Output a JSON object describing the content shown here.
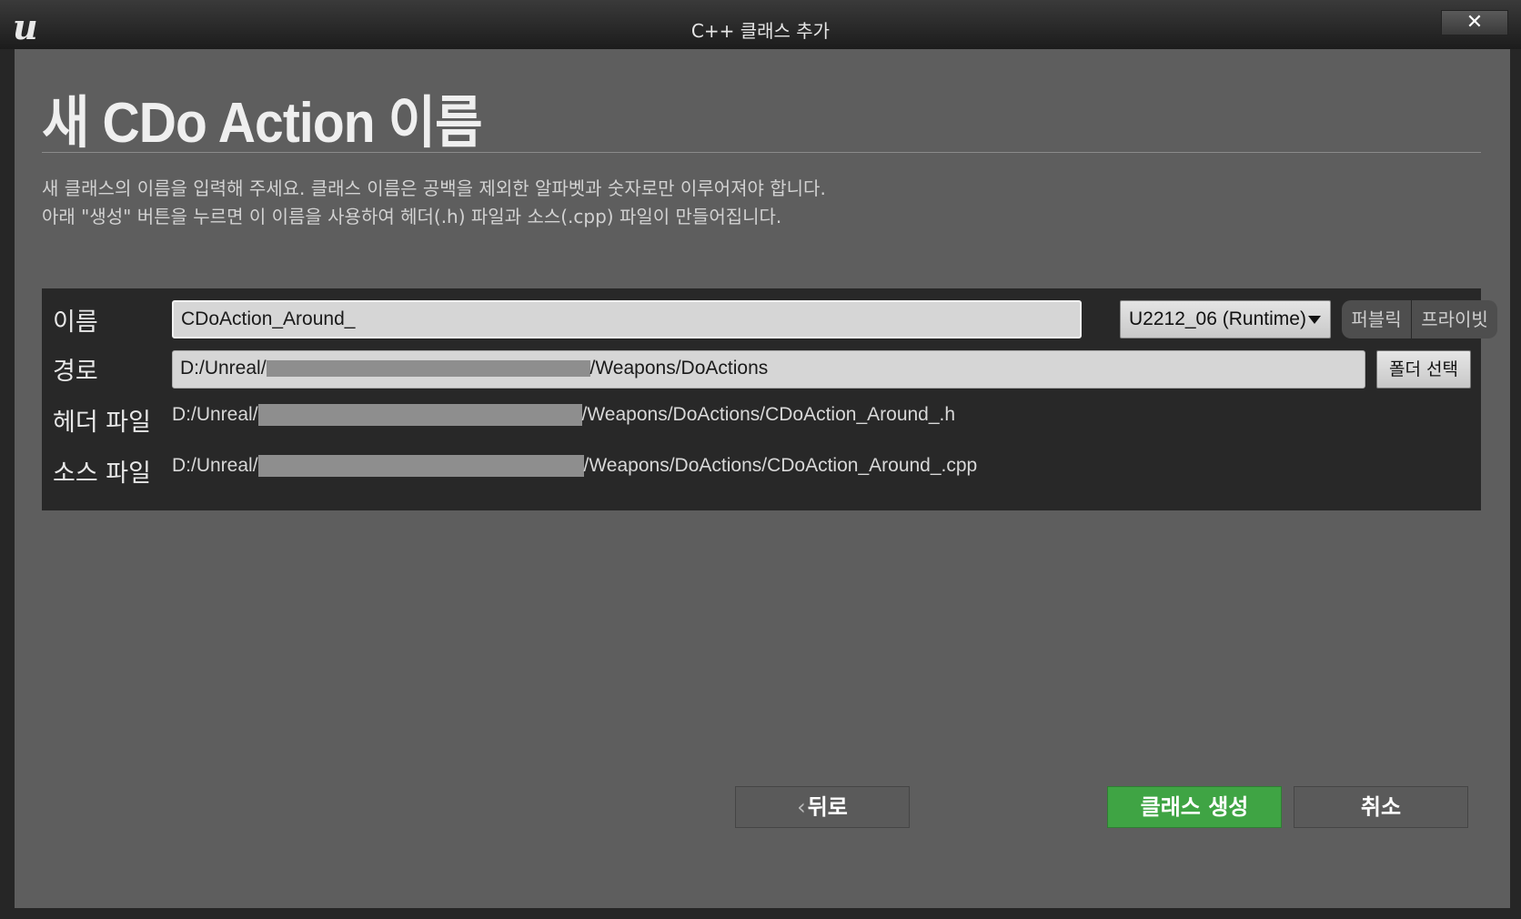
{
  "window": {
    "title": "C++ 클래스 추가",
    "logo_letter": "u",
    "close_label": "✕"
  },
  "page": {
    "heading": "새 CDo Action 이름",
    "description_line1": "새 클래스의 이름을 입력해 주세요. 클래스 이름은 공백을 제외한 알파벳과 숫자로만 이루어져야 합니다.",
    "description_line2": "아래 \"생성\" 버튼을 누르면 이 이름을 사용하여 헤더(.h) 파일과 소스(.cpp) 파일이 만들어집니다."
  },
  "form": {
    "name_label": "이름",
    "name_value": "CDoAction_Around_",
    "module_value": "U2212_06 (Runtime)",
    "public_label": "퍼블릭",
    "private_label": "프라이빗",
    "path_label": "경로",
    "path_prefix": "D:/Unreal/",
    "path_suffix": "/Weapons/DoActions",
    "folder_button": "폴더 선택",
    "header_label": "헤더 파일",
    "header_prefix": "D:/Unreal/",
    "header_suffix": "/Weapons/DoActions/CDoAction_Around_.h",
    "source_label": "소스 파일",
    "source_prefix": "D:/Unreal/",
    "source_suffix": "/Weapons/DoActions/CDoAction_Around_.cpp"
  },
  "footer": {
    "back_chevron": "‹",
    "back_label": "뒤로",
    "create_label": "클래스 생성",
    "cancel_label": "취소"
  },
  "colors": {
    "accent_create": "#3fa444",
    "panel": "#5e5e5e",
    "form_bg": "#282828"
  }
}
